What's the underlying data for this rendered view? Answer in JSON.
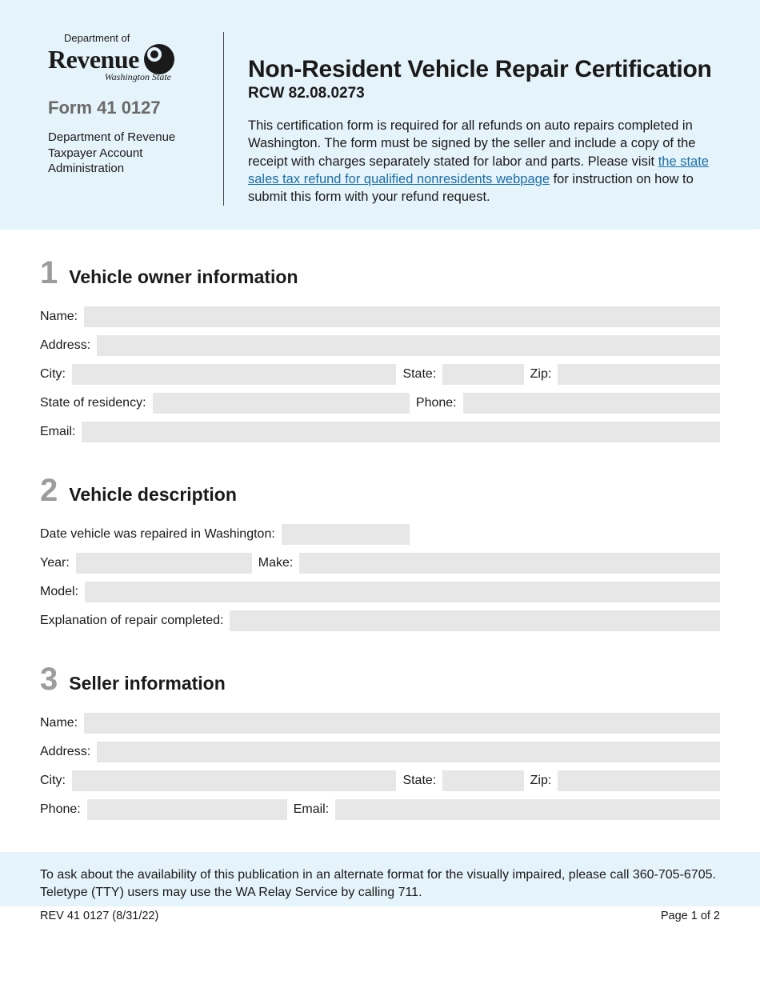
{
  "logo": {
    "top": "Department of",
    "main": "Revenue",
    "sub": "Washington State"
  },
  "form_number": "Form 41 0127",
  "dept_lines": "Department of Revenue Taxpayer Account Administration",
  "title": "Non-Resident Vehicle Repair Certification",
  "subtitle": "RCW 82.08.0273",
  "intro_pre": "This certification form is required for all refunds on auto repairs completed in Washington. The form must be signed by the seller and include a copy of the receipt with charges separately stated for labor and parts. Please visit ",
  "intro_link": "the state sales tax refund for qualified nonresidents webpage",
  "intro_post": " for instruction on how to submit this form with your refund request.",
  "sections": {
    "s1": {
      "num": "1",
      "title": "Vehicle owner information",
      "labels": {
        "name": "Name:",
        "address": "Address:",
        "city": "City:",
        "state": "State:",
        "zip": "Zip:",
        "residency": "State of residency:",
        "phone": "Phone:",
        "email": "Email:"
      }
    },
    "s2": {
      "num": "2",
      "title": "Vehicle description",
      "labels": {
        "date": "Date vehicle was repaired in Washington:",
        "year": "Year:",
        "make": "Make:",
        "model": "Model:",
        "explanation": "Explanation of repair completed:"
      }
    },
    "s3": {
      "num": "3",
      "title": "Seller information",
      "labels": {
        "name": "Name:",
        "address": "Address:",
        "city": "City:",
        "state": "State:",
        "zip": "Zip:",
        "phone": "Phone:",
        "email": "Email:"
      }
    }
  },
  "footer_note": "To ask about the availability of this publication in an alternate format for the visually impaired, please call 360-705-6705. Teletype (TTY) users may use the WA Relay Service by calling 711.",
  "footer_left": "REV 41 0127  (8/31/22)",
  "footer_right": "Page 1 of 2"
}
